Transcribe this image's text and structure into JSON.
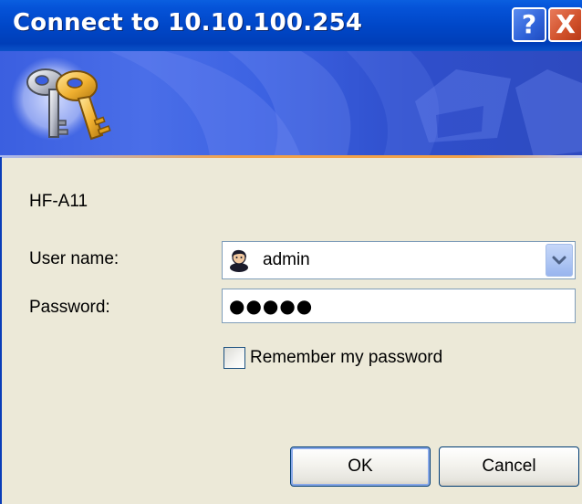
{
  "window": {
    "title": "Connect to 10.10.100.254",
    "help_button": "?",
    "close_button": "X"
  },
  "banner": {
    "icon": "keys-icon"
  },
  "form": {
    "server_name": "HF-A11",
    "username_label": "User name:",
    "username_value": "admin",
    "password_label": "Password:",
    "password_value": "●●●●●",
    "remember_label": "Remember my password",
    "remember_checked": false
  },
  "buttons": {
    "ok": "OK",
    "cancel": "Cancel"
  },
  "colors": {
    "titlebar": "#0047C8",
    "banner": "#3C62E2",
    "dialog_bg": "#ECE9D8",
    "accent_strip": "#F2A24A"
  }
}
